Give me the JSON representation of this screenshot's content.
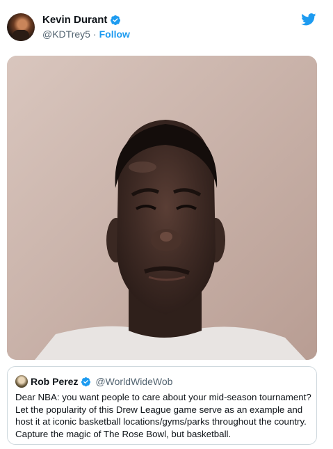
{
  "author": {
    "display_name": "Kevin Durant",
    "handle": "@KDTrey5",
    "separator": "·",
    "follow_label": "Follow",
    "verified": true
  },
  "quoted_tweet": {
    "display_name": "Rob Perez",
    "handle": "@WorldWideWob",
    "verified": true,
    "text": "Dear NBA: you want people to care about your mid-season tournament? Let the popularity of this Drew League game serve as an example and host it at iconic basketball locations/gyms/parks throughout the country. Capture the magic of The Rose Bowl, but basketball."
  },
  "icons": {
    "verified": "verified-badge-icon",
    "brand": "twitter-bird-icon"
  },
  "colors": {
    "accent": "#1d9bf0",
    "secondary_text": "#536471",
    "border": "#cfd9de"
  }
}
